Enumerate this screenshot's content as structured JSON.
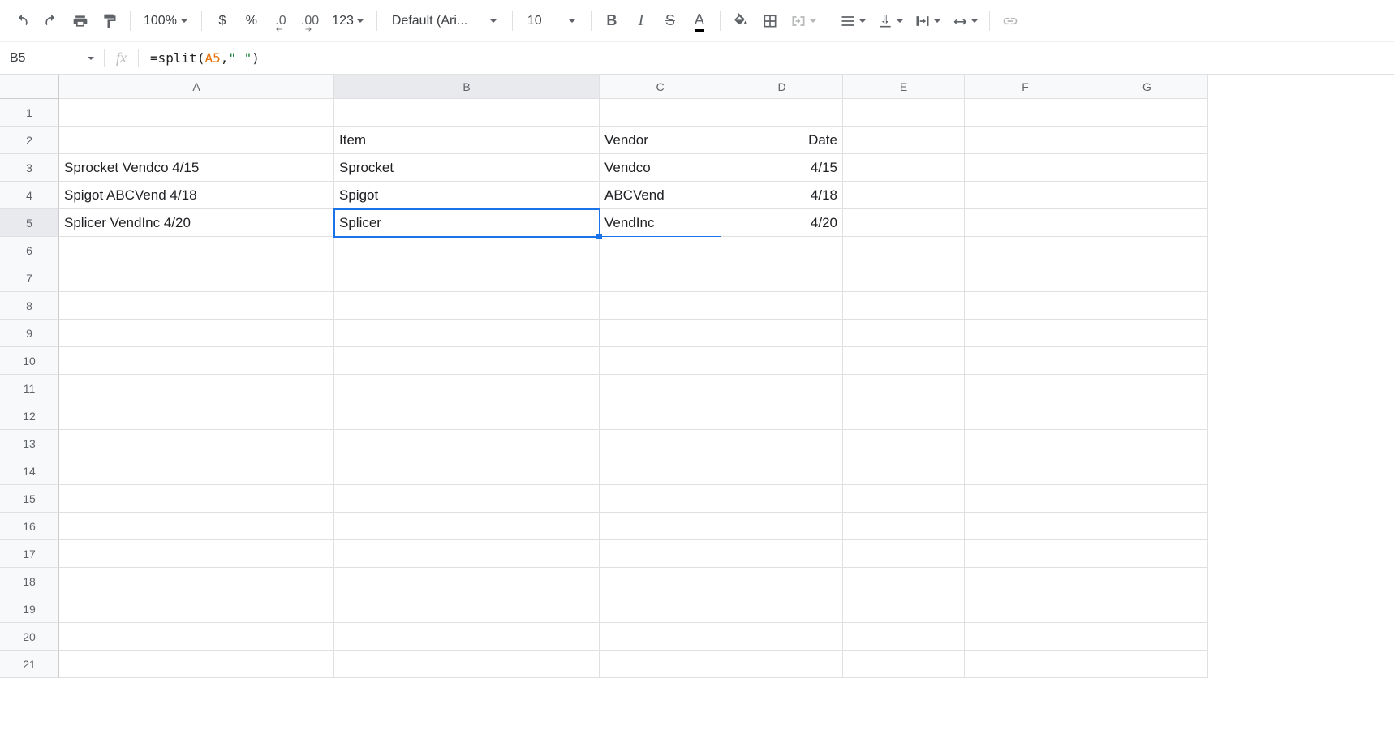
{
  "toolbar": {
    "zoom": "100%",
    "currency": "$",
    "percent": "%",
    "dec_dec": ".0",
    "inc_dec": ".00",
    "more_fmt": "123",
    "font": "Default (Ari...",
    "font_size": "10",
    "bold": "B",
    "italic": "I",
    "strike": "S",
    "textcolor": "A"
  },
  "namebox": "B5",
  "fx_label": "fx",
  "formula": {
    "eq": "=",
    "fn": "split",
    "open": "(",
    "ref": "A5",
    "comma": ",",
    "str": "\" \"",
    "close": ")"
  },
  "columns": [
    "A",
    "B",
    "C",
    "D",
    "E",
    "F",
    "G"
  ],
  "row_count": 21,
  "cells": {
    "A2": "",
    "B2": "Item",
    "C2": "Vendor",
    "D2": "Date",
    "A3": "Sprocket Vendco 4/15",
    "B3": "Sprocket",
    "C3": "Vendco",
    "D3": "4/15",
    "A4": "Spigot  ABCVend 4/18",
    "B4": "Spigot",
    "C4": "ABCVend",
    "D4": "4/18",
    "A5": "Splicer  VendInc 4/20",
    "B5": "Splicer",
    "C5": "VendInc",
    "D5": "4/20"
  },
  "selected_cell": "B5"
}
